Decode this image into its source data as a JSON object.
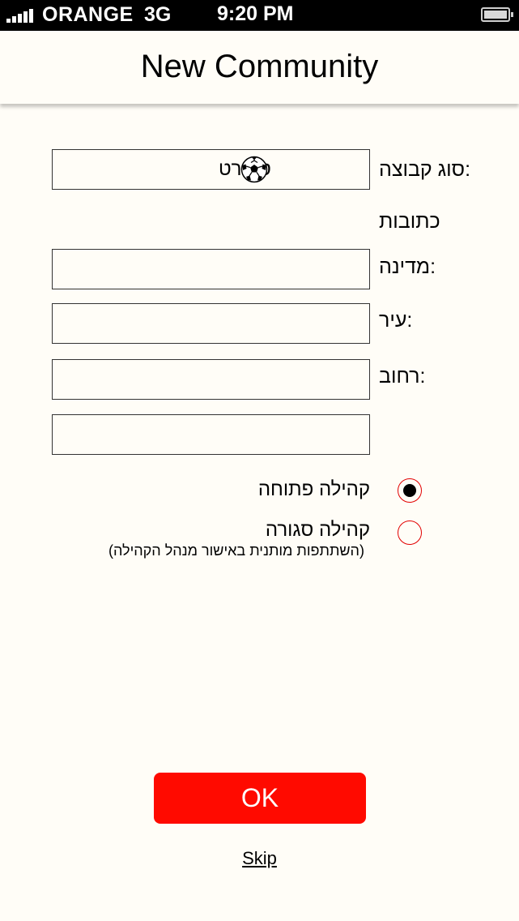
{
  "status_bar": {
    "carrier": "ORANGE",
    "network": "3G",
    "time": "9:20 PM",
    "signal_icon": "signal-bars-icon",
    "battery_icon": "battery-icon"
  },
  "header": {
    "title": "New Community"
  },
  "form": {
    "group_type_label": "סוג קבוצה:",
    "group_type_value": "ספורט",
    "group_type_icon": "soccer-ball-icon",
    "address_label": "כתובות",
    "country_label": "מדינה:",
    "country_value": "",
    "city_label": "עיר:",
    "city_value": "",
    "street_label": "רחוב:",
    "street_value": "",
    "extra_value": ""
  },
  "privacy": {
    "options": [
      {
        "label": "קהילה פתוחה",
        "selected": true
      },
      {
        "label": "קהילה סגורה",
        "selected": false
      }
    ],
    "closed_note": "(השתתפות מותנית באישור מנהל הקהילה)",
    "accent_color": "#e20000"
  },
  "actions": {
    "ok_label": "OK",
    "ok_color": "#ff0a00",
    "skip_label": "Skip"
  }
}
